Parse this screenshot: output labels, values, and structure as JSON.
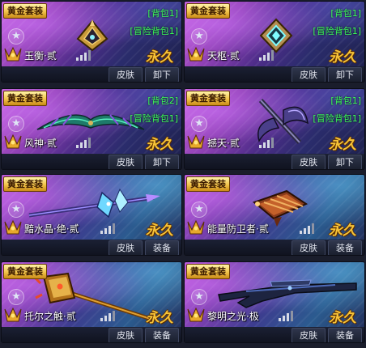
{
  "items": [
    {
      "badge": "黄金套装",
      "name": "玉衡·贰",
      "duration": "永久",
      "tags": [
        "[背包1]",
        "[冒险背包1]"
      ],
      "actions": [
        "皮肤",
        "卸下"
      ],
      "icon": "golden-wing-ornament-icon"
    },
    {
      "badge": "黄金套装",
      "name": "天枢·贰",
      "duration": "永久",
      "tags": [
        "[背包1]",
        "[冒险背包1]"
      ],
      "actions": [
        "皮肤",
        "卸下"
      ],
      "icon": "cyan-diamond-ornament-icon"
    },
    {
      "badge": "黄金套装",
      "name": "风神·贰",
      "duration": "永久",
      "tags": [
        "[背包2]",
        "[冒险背包1]"
      ],
      "actions": [
        "皮肤",
        "卸下"
      ],
      "icon": "feathered-blade-icon"
    },
    {
      "badge": "黄金套装",
      "name": "撼天·贰",
      "duration": "永久",
      "tags": [
        "[背包1]",
        "[冒险背包1]"
      ],
      "actions": [
        "皮肤",
        "卸下"
      ],
      "icon": "battle-axe-icon"
    },
    {
      "badge": "黄金套装",
      "name": "黯水晶·绝·贰",
      "duration": "永久",
      "tags": [],
      "actions": [
        "皮肤",
        "装备"
      ],
      "icon": "crystal-lance-icon"
    },
    {
      "badge": "黄金套装",
      "name": "能量防卫者·贰",
      "duration": "永久",
      "tags": [],
      "actions": [
        "皮肤",
        "装备"
      ],
      "icon": "energy-shield-icon"
    },
    {
      "badge": "黄金套装",
      "name": "托尔之触·贰",
      "duration": "永久",
      "tags": [],
      "actions": [
        "皮肤",
        "装备"
      ],
      "icon": "thunder-hammer-icon"
    },
    {
      "badge": "黄金套装",
      "name": "黎明之光·极",
      "duration": "永久",
      "tags": [],
      "actions": [
        "皮肤",
        "装备"
      ],
      "icon": "dawn-rifle-icon"
    }
  ]
}
